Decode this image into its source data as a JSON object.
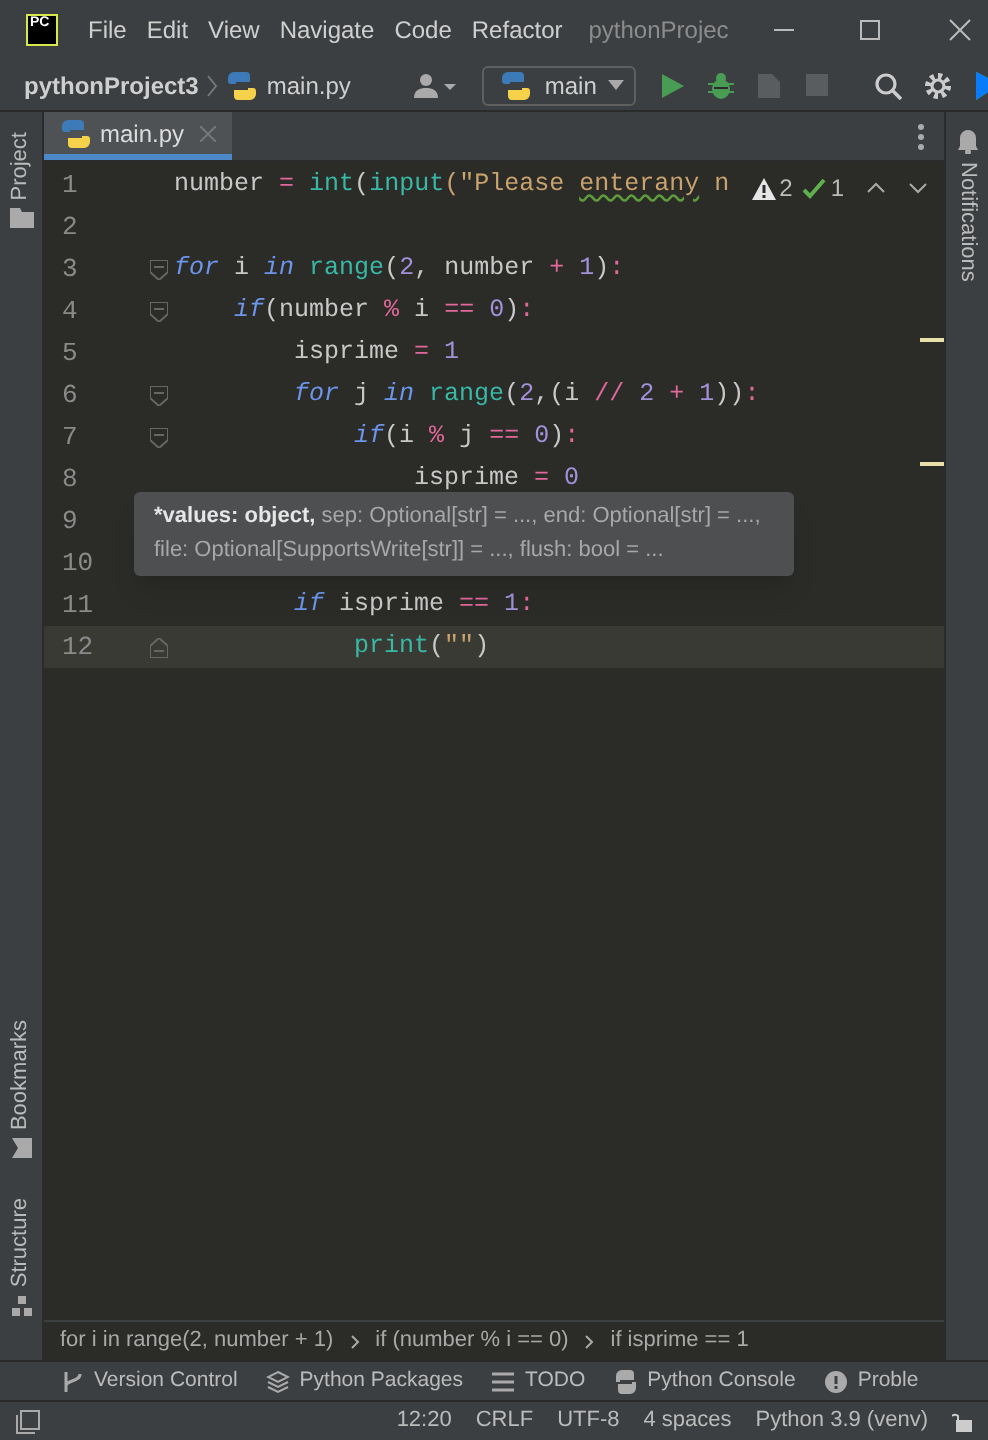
{
  "title_bar": {
    "logo": "PC",
    "menus": [
      "File",
      "Edit",
      "View",
      "Navigate",
      "Code",
      "Refactor"
    ],
    "title": "pythonProjec"
  },
  "toolbar": {
    "project": "pythonProject3",
    "file": "main.py",
    "run_config": "main"
  },
  "tabs": [
    {
      "label": "main.py",
      "selected": true
    }
  ],
  "side_left": [
    "Project",
    "Bookmarks",
    "Structure"
  ],
  "side_right": [
    "Notifications"
  ],
  "inspections": {
    "warnings": "2",
    "ok": "1"
  },
  "code_lines": [
    {
      "number": "1",
      "fold": false,
      "current": false,
      "tokens": [
        {
          "text": "number ",
          "kind": "id"
        },
        {
          "text": "= ",
          "kind": "op"
        },
        {
          "text": "int",
          "kind": "fn"
        },
        {
          "text": "(",
          "kind": "id"
        },
        {
          "text": "input",
          "kind": "fn"
        },
        {
          "text": "(\"Please ",
          "kind": "str"
        },
        {
          "text": "enterany",
          "kind": "typo"
        },
        {
          "text": " n",
          "kind": "str"
        }
      ]
    },
    {
      "number": "2",
      "fold": false,
      "current": false
    },
    {
      "number": "3",
      "fold": true,
      "current": false,
      "tokens": [
        {
          "text": "for",
          "kind": "kw"
        },
        {
          "text": " i ",
          "kind": "id"
        },
        {
          "text": "in ",
          "kind": "kw"
        },
        {
          "text": "range",
          "kind": "fn"
        },
        {
          "text": "(",
          "kind": "id"
        },
        {
          "text": "2",
          "kind": "num"
        },
        {
          "text": ", number ",
          "kind": "id"
        },
        {
          "text": "+ ",
          "kind": "op"
        },
        {
          "text": "1",
          "kind": "num"
        },
        {
          "text": ")",
          "kind": "id"
        },
        {
          "text": ":",
          "kind": "op"
        }
      ]
    },
    {
      "number": "4",
      "fold": true,
      "current": false,
      "tokens": [
        {
          "text": "    if",
          "kind": "kw"
        },
        {
          "text": "(number ",
          "kind": "id"
        },
        {
          "text": "% ",
          "kind": "op"
        },
        {
          "text": "i ",
          "kind": "id"
        },
        {
          "text": "== ",
          "kind": "op"
        },
        {
          "text": "0",
          "kind": "num"
        },
        {
          "text": ")",
          "kind": "id"
        },
        {
          "text": ":",
          "kind": "op"
        }
      ]
    },
    {
      "number": "5",
      "fold": false,
      "current": false,
      "tokens": [
        {
          "text": "        isprime ",
          "kind": "id"
        },
        {
          "text": "= ",
          "kind": "op"
        },
        {
          "text": "1",
          "kind": "num"
        }
      ]
    },
    {
      "number": "6",
      "fold": true,
      "current": false,
      "tokens": [
        {
          "text": "        for",
          "kind": "kw"
        },
        {
          "text": " j ",
          "kind": "id"
        },
        {
          "text": "in ",
          "kind": "kw"
        },
        {
          "text": "range",
          "kind": "fn"
        },
        {
          "text": "(",
          "kind": "id"
        },
        {
          "text": "2",
          "kind": "num"
        },
        {
          "text": ",(i ",
          "kind": "id"
        },
        {
          "text": "// ",
          "kind": "op"
        },
        {
          "text": "2 ",
          "kind": "num"
        },
        {
          "text": "+ ",
          "kind": "op"
        },
        {
          "text": "1",
          "kind": "num"
        },
        {
          "text": "))",
          "kind": "id"
        },
        {
          "text": ":",
          "kind": "op"
        }
      ]
    },
    {
      "number": "7",
      "fold": true,
      "current": false,
      "tokens": [
        {
          "text": "            if",
          "kind": "kw"
        },
        {
          "text": "(i ",
          "kind": "id"
        },
        {
          "text": "% ",
          "kind": "op"
        },
        {
          "text": "j ",
          "kind": "id"
        },
        {
          "text": "== ",
          "kind": "op"
        },
        {
          "text": "0",
          "kind": "num"
        },
        {
          "text": ")",
          "kind": "id"
        },
        {
          "text": ":",
          "kind": "op"
        }
      ]
    },
    {
      "number": "8",
      "fold": false,
      "current": false,
      "tokens": [
        {
          "text": "                isprime ",
          "kind": "id"
        },
        {
          "text": "= ",
          "kind": "op"
        },
        {
          "text": "0",
          "kind": "num"
        }
      ]
    },
    {
      "number": "9",
      "fold": false,
      "current": false
    },
    {
      "number": "10",
      "fold": false,
      "current": false
    },
    {
      "number": "11",
      "fold": false,
      "current": false,
      "tokens": [
        {
          "text": "        if",
          "kind": "kw"
        },
        {
          "text": " isprime ",
          "kind": "id"
        },
        {
          "text": "== ",
          "kind": "op"
        },
        {
          "text": "1",
          "kind": "num"
        },
        {
          "text": ":",
          "kind": "op"
        }
      ]
    },
    {
      "number": "12",
      "fold": true,
      "current": true,
      "tokens": [
        {
          "text": "            print",
          "kind": "fn"
        },
        {
          "text": "(",
          "kind": "id"
        },
        {
          "text": "\"\"",
          "kind": "str"
        },
        {
          "text": ")",
          "kind": "id"
        }
      ]
    }
  ],
  "parameter_info": {
    "current": "*values: object,",
    "rest": " sep: Optional[str] = ..., end: Optional[str] = ..., file: Optional[SupportsWrite[str]] = ..., flush: bool = ..."
  },
  "breadcrumbs": [
    "for i in range(2, number + 1)",
    "if (number % i == 0)",
    "if isprime == 1"
  ],
  "tool_windows": [
    {
      "label": "Version Control",
      "kind": "vcs"
    },
    {
      "label": "Python Packages",
      "kind": "packages"
    },
    {
      "label": "TODO",
      "kind": "todo"
    },
    {
      "label": "Python Console",
      "kind": "console"
    },
    {
      "label": "Proble",
      "kind": "problems"
    }
  ],
  "status": [
    "12:20",
    "CRLF",
    "UTF-8",
    "4 spaces",
    "Python 3.9 (venv)"
  ]
}
